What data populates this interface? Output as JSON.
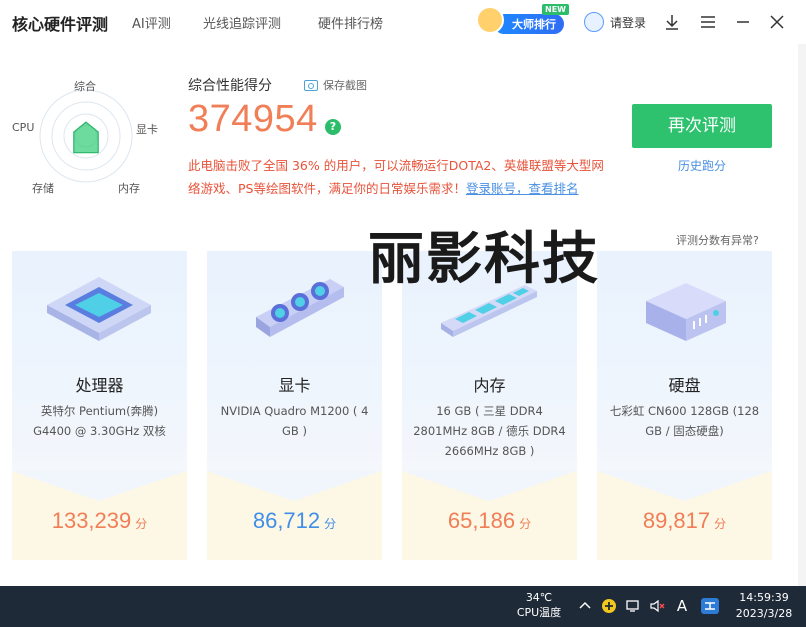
{
  "header": {
    "brand": "核心硬件评测",
    "tabs": [
      "AI评测",
      "光线追踪评测",
      "硬件排行榜"
    ],
    "master_label": "大师排行",
    "new_tag": "NEW",
    "login_label": "请登录"
  },
  "radar": {
    "labels": {
      "top": "综合",
      "right": "显卡",
      "left": "CPU",
      "bottom_left": "存储",
      "bottom_right": "内存"
    },
    "levels": {
      "综合": 0.3,
      "显卡": 0.28,
      "内存": 0.45,
      "存储": 0.45,
      "CPU": 0.28
    }
  },
  "summary": {
    "title": "综合性能得分",
    "save_label": "保存截图",
    "score": "374954",
    "help": "?",
    "desc": "此电脑击败了全国 36% 的用户，可以流畅运行DOTA2、英雄联盟等大型网络游戏、PS等绘图软件，满足你的日常娱乐需求！",
    "desc_link": "登录账号，查看排名",
    "retest_label": "再次评测",
    "history_label": "历史跑分",
    "anomaly_label": "评测分数有异常?"
  },
  "watermark": "丽影科技",
  "cards": [
    {
      "name": "处理器",
      "spec": "英特尔 Pentium(奔腾) G4400 @ 3.30GHz 双核",
      "score": "133,239",
      "unit": "分",
      "color": "#f07e56"
    },
    {
      "name": "显卡",
      "spec": "NVIDIA Quadro M1200 ( 4 GB )",
      "score": "86,712",
      "unit": "分",
      "color": "#3f8ee8"
    },
    {
      "name": "内存",
      "spec": "16 GB ( 三星 DDR4 2801MHz 8GB / 德乐 DDR4 2666MHz 8GB )",
      "score": "65,186",
      "unit": "分",
      "color": "#f07e56"
    },
    {
      "name": "硬盘",
      "spec": "七彩虹 CN600 128GB (128 GB / 固态硬盘)",
      "score": "89,817",
      "unit": "分",
      "color": "#f07e56"
    }
  ],
  "taskbar": {
    "temp": "34℃",
    "temp_label": "CPU温度",
    "time": "14:59:39",
    "date": "2023/3/28",
    "ime": "A"
  }
}
